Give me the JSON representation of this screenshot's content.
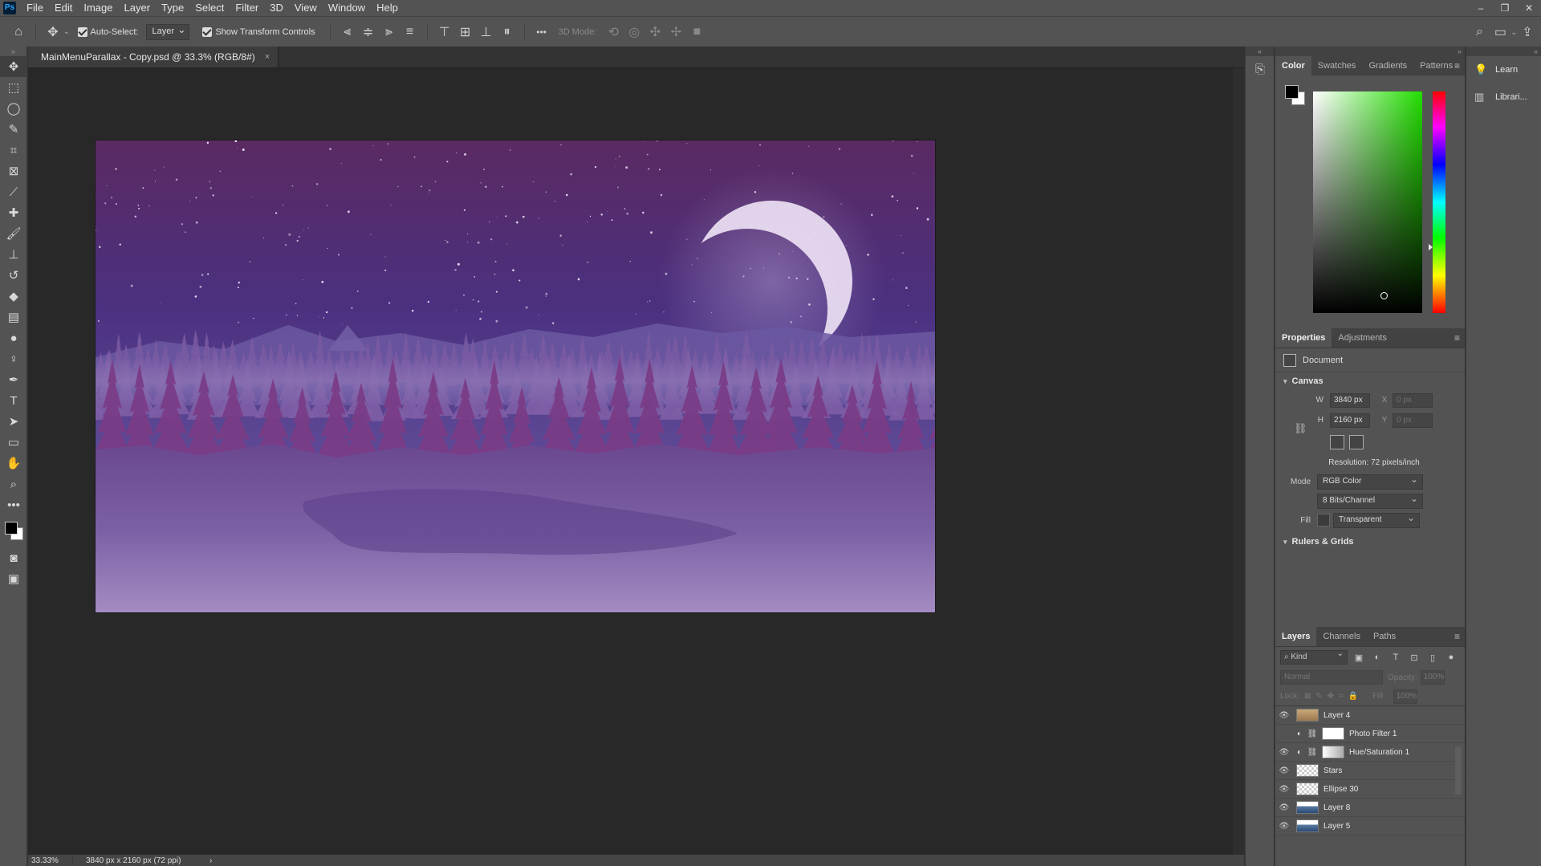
{
  "menubar": {
    "logo": "Ps",
    "items": [
      "File",
      "Edit",
      "Image",
      "Layer",
      "Type",
      "Select",
      "Filter",
      "3D",
      "View",
      "Window",
      "Help"
    ],
    "window_controls": [
      "–",
      "❐",
      "✕"
    ]
  },
  "options": {
    "auto_select_label": "Auto-Select:",
    "auto_select_value": "Layer",
    "show_transform_label": "Show Transform Controls",
    "more": "•••",
    "mode_3d_label": "3D Mode:"
  },
  "document": {
    "tab_title": "MainMenuParallax - Copy.psd @ 33.3% (RGB/8#)",
    "close": "×",
    "zoom": "33.33%",
    "size_info": "3840 px x 2160 px (72 ppi)",
    "status_arrow": "›"
  },
  "color_panel": {
    "tabs": [
      "Color",
      "Swatches",
      "Gradients",
      "Patterns"
    ],
    "menu": "≡",
    "foreground": "#000000",
    "background": "#ffffff"
  },
  "properties_panel": {
    "tabs": [
      "Properties",
      "Adjustments"
    ],
    "menu": "≡",
    "doc_label": "Document",
    "canvas_section": "Canvas",
    "w_label": "W",
    "w_value": "3840 px",
    "h_label": "H",
    "h_value": "2160 px",
    "x_label": "X",
    "x_value": "0 px",
    "y_label": "Y",
    "y_value": "0 px",
    "resolution": "Resolution: 72 pixels/inch",
    "mode_label": "Mode",
    "mode_value": "RGB Color",
    "bits_value": "8 Bits/Channel",
    "fill_label": "Fill",
    "fill_value": "Transparent",
    "rulers_section": "Rulers & Grids"
  },
  "layers_panel": {
    "tabs": [
      "Layers",
      "Channels",
      "Paths"
    ],
    "menu": "≡",
    "kind_label": "Kind",
    "blend_mode": "Normal",
    "opacity_label": "Opacity:",
    "opacity_value": "100%",
    "lock_label": "Lock:",
    "fill_label": "Fill:",
    "fill_value": "100%",
    "layers": [
      {
        "name": "Layer 4",
        "visible": true,
        "thumb": "brown",
        "adjustment": false
      },
      {
        "name": "Photo Filter 1",
        "visible": false,
        "thumb": "white",
        "adjustment": true
      },
      {
        "name": "Hue/Saturation 1",
        "visible": true,
        "thumb": "grad",
        "adjustment": true
      },
      {
        "name": "Stars",
        "visible": true,
        "thumb": "check",
        "adjustment": false
      },
      {
        "name": "Ellipse 30",
        "visible": true,
        "thumb": "check",
        "adjustment": false
      },
      {
        "name": "Layer 8",
        "visible": true,
        "thumb": "blue",
        "adjustment": false
      },
      {
        "name": "Layer 5",
        "visible": true,
        "thumb": "blue",
        "adjustment": false
      }
    ]
  },
  "side_panels": {
    "learn": "Learn",
    "libraries": "Librari..."
  },
  "canvas_colors": {
    "sky_top": "#5b2a63",
    "sky_mid": "#4f3a8a",
    "mountains": "#6d5aa3",
    "trees_back": "#7a5aa2",
    "trees_front": "#7a3c86",
    "ground": "#6a4d95",
    "ground_light": "#a88cc4",
    "moon": "#e8d8f0"
  }
}
